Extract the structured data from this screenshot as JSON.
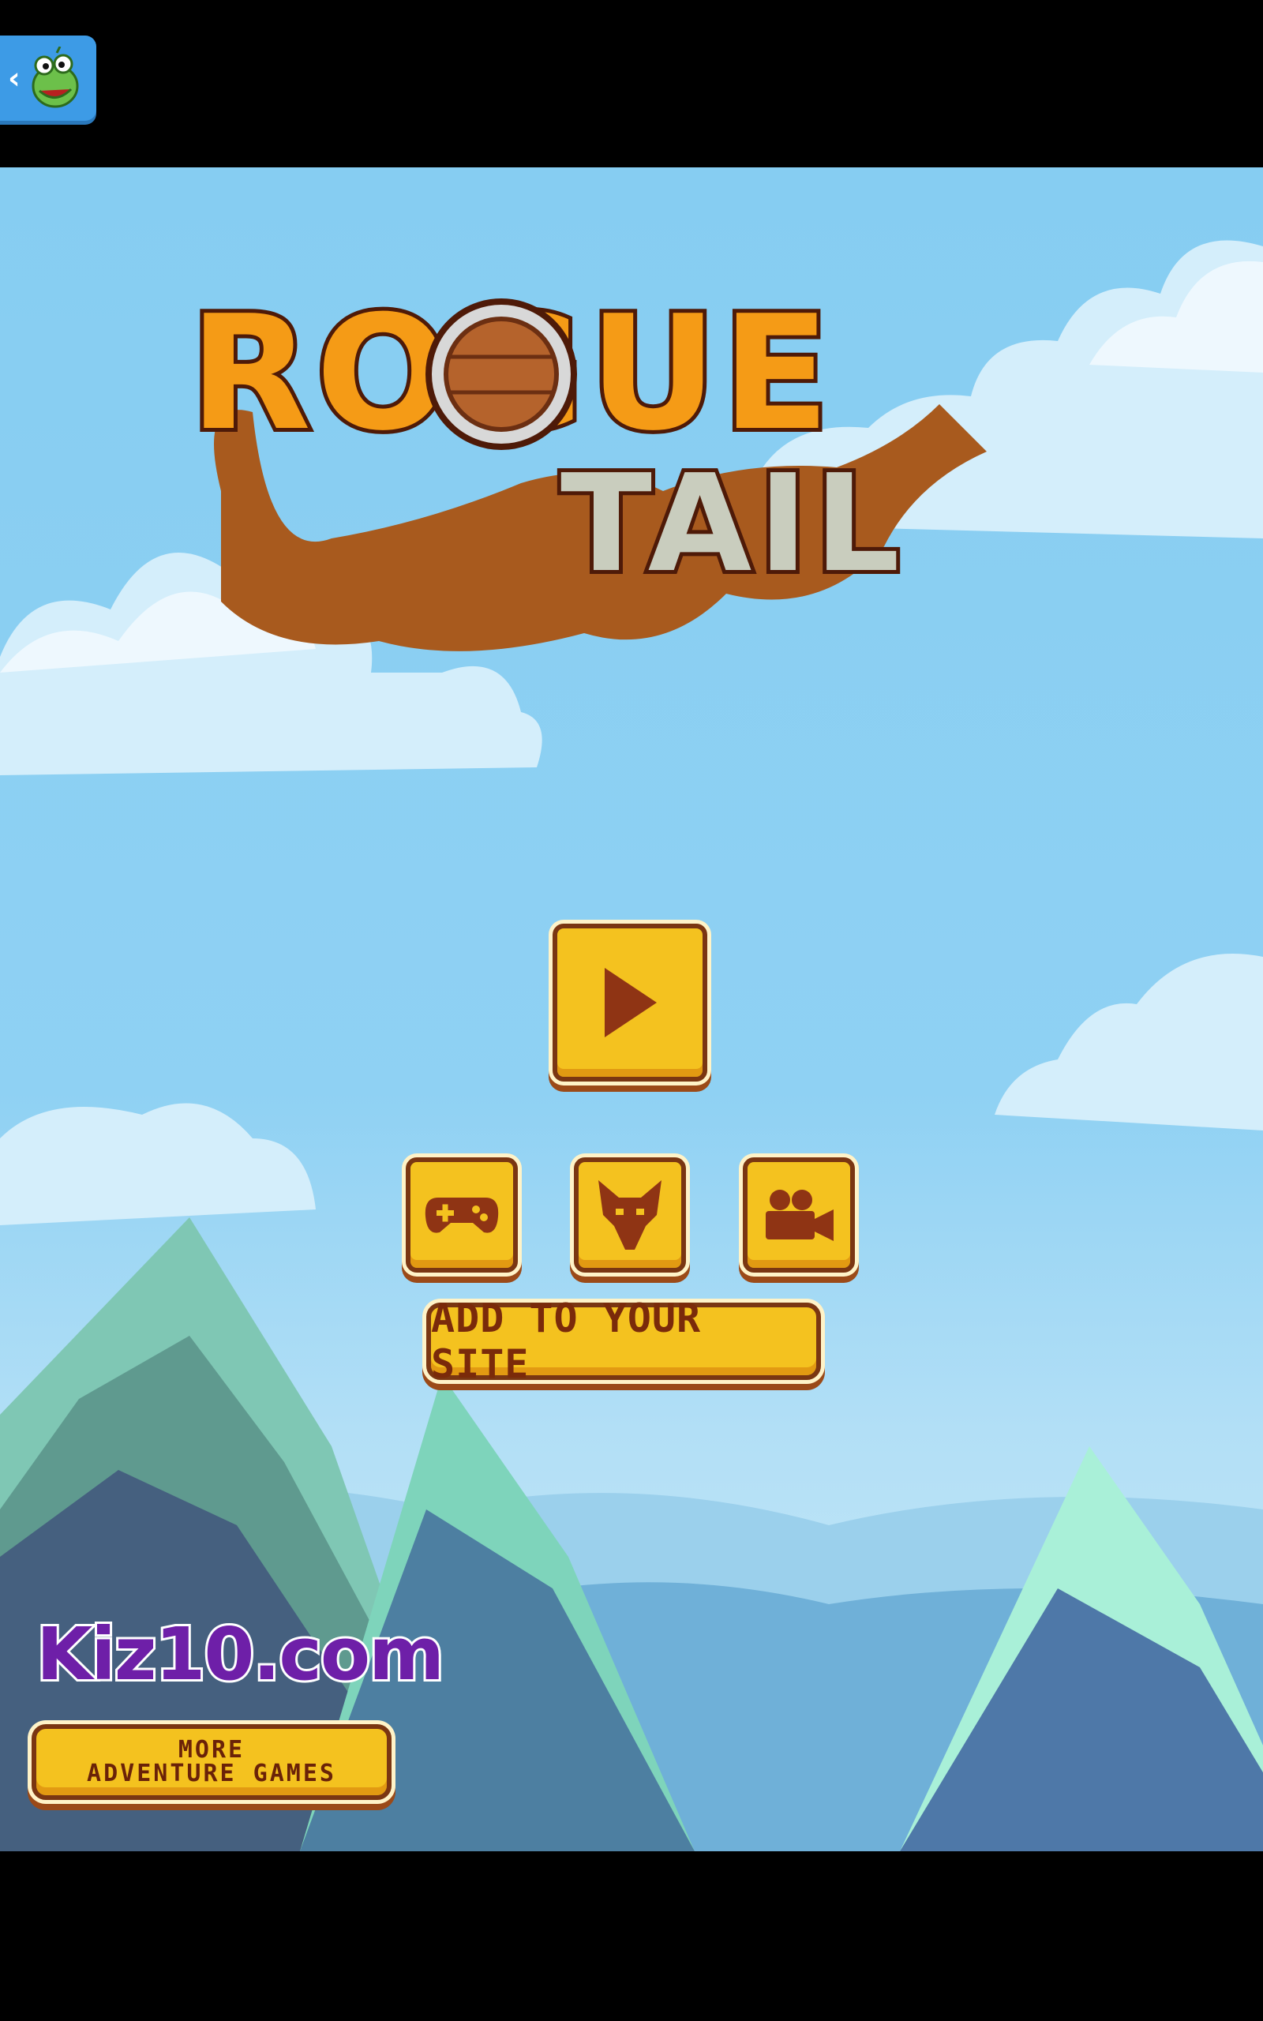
{
  "app": {
    "back_icon": "chevron-left-icon",
    "mascot_icon": "frog-mascot-icon",
    "accent": "#3d9be6"
  },
  "logo": {
    "line1": "ROGUE",
    "line2": "TAIL"
  },
  "menu": {
    "play_icon": "play-icon",
    "controls_icon": "gamepad-icon",
    "character_icon": "fox-head-icon",
    "video_icon": "video-camera-icon",
    "add_site_label": "ADD TO YOUR SITE",
    "button_color": "#f4c21f",
    "button_border": "#7a3612"
  },
  "footer": {
    "brand": "Kiz10.com",
    "more_line1": "MORE",
    "more_line2": "ADVENTURE GAMES"
  }
}
